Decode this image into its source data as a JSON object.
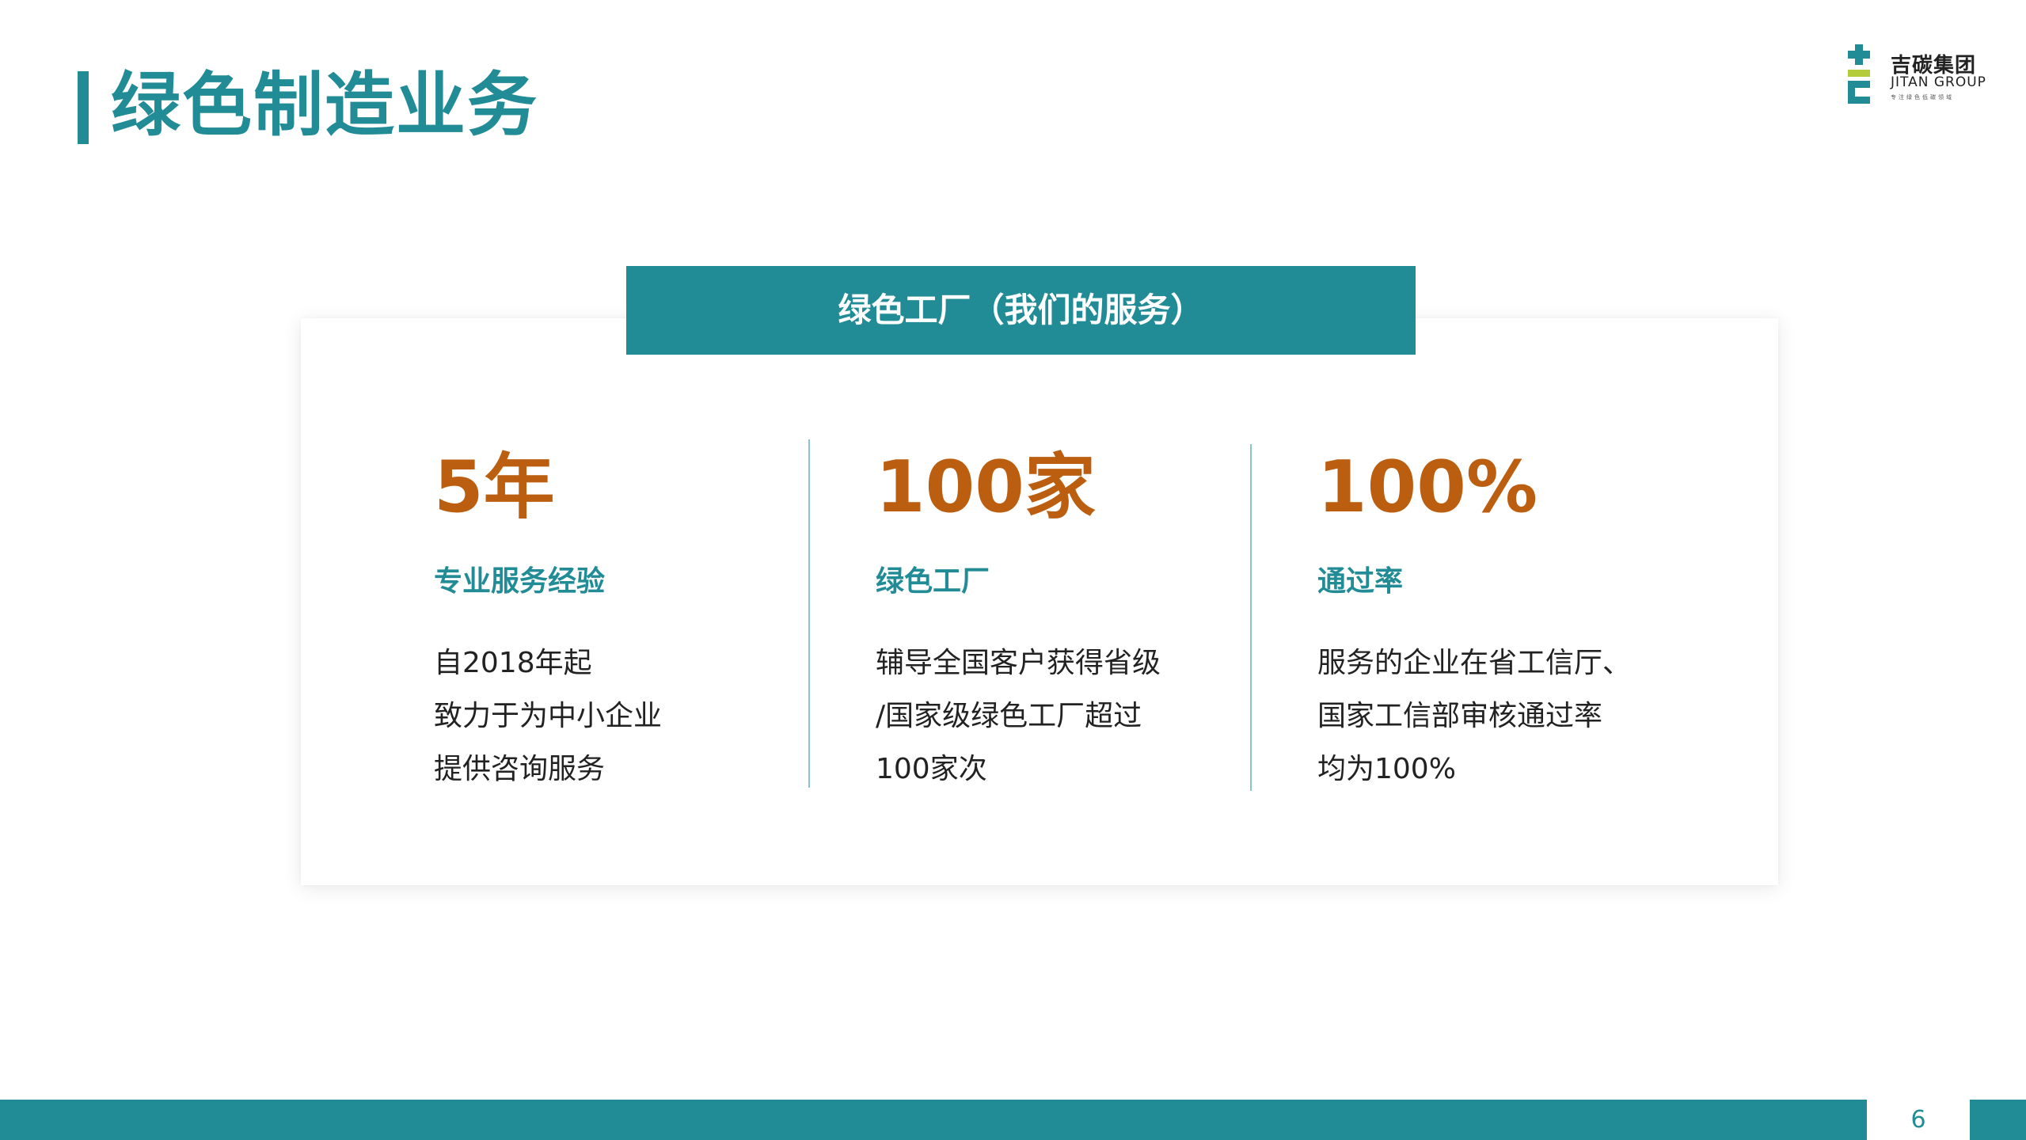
{
  "header": {
    "title": "绿色制造业务"
  },
  "logo": {
    "name_cn": "吉碳集团",
    "name_en": "JITAN GROUP",
    "tagline": "专注绿色低碳领域"
  },
  "card": {
    "header_label": "绿色工厂（我们的服务）",
    "stats": [
      {
        "value": "5年",
        "label": "专业服务经验",
        "lines": [
          "自2018年起",
          "致力于为中小企业",
          "提供咨询服务"
        ]
      },
      {
        "value": "100家",
        "label": "绿色工厂",
        "lines": [
          "辅导全国客户获得省级",
          "/国家级绿色工厂超过",
          "100家次"
        ]
      },
      {
        "value": "100%",
        "label": "通过率",
        "lines": [
          "服务的企业在省工信厅、",
          "国家工信部审核通过率",
          "均为100%"
        ]
      }
    ]
  },
  "footer": {
    "page_number": "6"
  },
  "colors": {
    "accent": "#218b96",
    "stat_value": "#bb5e0f",
    "logo_green": "#b5cc3a"
  }
}
